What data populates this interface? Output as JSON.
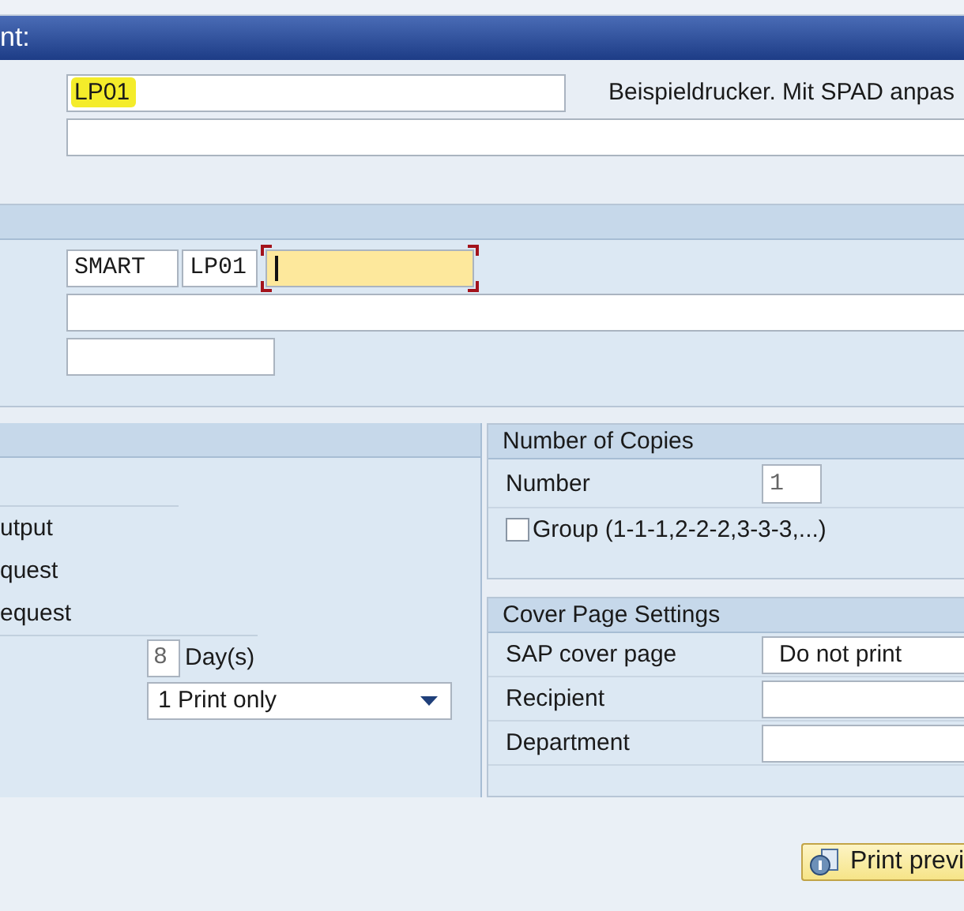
{
  "header": {
    "title": "nt:"
  },
  "printer": {
    "value": "LP01",
    "highlighted": true,
    "description": "Beispieldrucker. Mit SPAD anpas"
  },
  "spool_request": {
    "name_parts": [
      "SMART",
      "LP01"
    ],
    "suffix_field": {
      "focused": true
    }
  },
  "output_panel": {
    "labels": [
      "utput",
      "quest",
      "equest"
    ],
    "retention": {
      "value": "8",
      "unit": "Day(s)"
    },
    "mode": {
      "value": "1 Print only"
    }
  },
  "copies": {
    "title": "Number of Copies",
    "number_label": "Number",
    "number": "1",
    "group": {
      "label": "Group (1-1-1,2-2-2,3-3-3,...)",
      "checked": false
    }
  },
  "cover": {
    "title": "Cover Page Settings",
    "rows": [
      {
        "label": "SAP cover page",
        "value": "Do not print"
      },
      {
        "label": "Recipient"
      },
      {
        "label": "Department"
      }
    ]
  },
  "footer": {
    "buttons": [
      {
        "label": "Print previ"
      }
    ]
  }
}
